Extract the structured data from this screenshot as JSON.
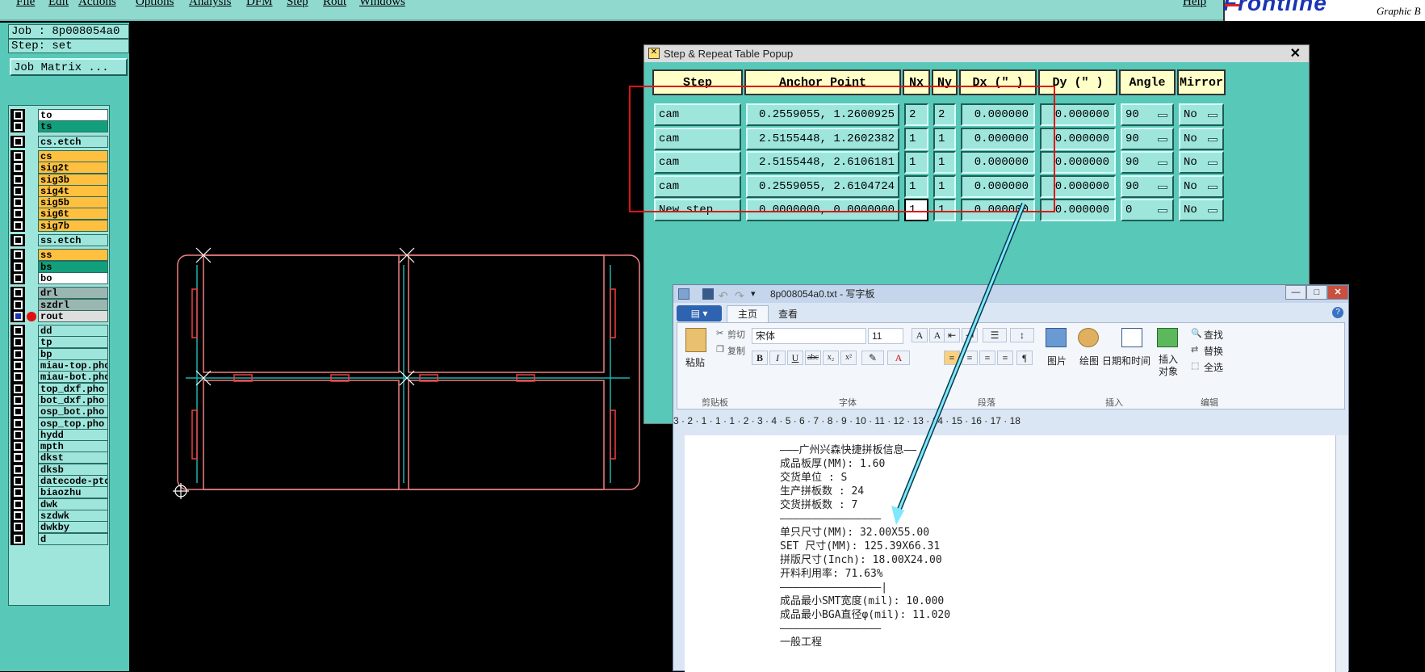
{
  "menubar": {
    "items": [
      "File",
      "Edit",
      "Actions",
      "Options",
      "Analysis",
      "DFM",
      "Step",
      "Rout",
      "Windows"
    ],
    "help": "Help",
    "brand": "Frontline",
    "brand_sub": "Graphic B"
  },
  "left_panel": {
    "job_label": "Job : 8p008054a0",
    "step_label": "Step: set",
    "job_matrix_button": "Job Matrix ...",
    "layers": [
      {
        "name": "to",
        "color": "#ffffff"
      },
      {
        "name": "ts",
        "color": "#12a07c"
      },
      {
        "name": "cs.etch",
        "color": "#9ee6dc"
      },
      {
        "name": "cs",
        "color": "#ffc040"
      },
      {
        "name": "sig2t",
        "color": "#ffc040"
      },
      {
        "name": "sig3b",
        "color": "#ffc040"
      },
      {
        "name": "sig4t",
        "color": "#ffc040"
      },
      {
        "name": "sig5b",
        "color": "#ffc040"
      },
      {
        "name": "sig6t",
        "color": "#ffc040"
      },
      {
        "name": "sig7b",
        "color": "#ffc040"
      },
      {
        "name": "ss.etch",
        "color": "#9ee6dc"
      },
      {
        "name": "ss",
        "color": "#ffc040"
      },
      {
        "name": "bs",
        "color": "#12a07c"
      },
      {
        "name": "bo",
        "color": "#ffffff"
      },
      {
        "name": "drl",
        "color": "#9ab6b0"
      },
      {
        "name": "szdrl",
        "color": "#9ab6b0"
      },
      {
        "name": "rout",
        "color": "#dedede"
      },
      {
        "name": "dd",
        "color": "#9ee6dc"
      },
      {
        "name": "tp",
        "color": "#9ee6dc"
      },
      {
        "name": "bp",
        "color": "#9ee6dc"
      },
      {
        "name": "miau-top.pho",
        "color": "#9ee6dc"
      },
      {
        "name": "miau-bot.pho",
        "color": "#9ee6dc"
      },
      {
        "name": "top_dxf.pho",
        "color": "#9ee6dc"
      },
      {
        "name": "bot_dxf.pho",
        "color": "#9ee6dc"
      },
      {
        "name": "osp_bot.pho",
        "color": "#9ee6dc"
      },
      {
        "name": "osp_top.pho",
        "color": "#9ee6dc"
      },
      {
        "name": "hydd",
        "color": "#9ee6dc"
      },
      {
        "name": "mpth",
        "color": "#9ee6dc"
      },
      {
        "name": "dkst",
        "color": "#9ee6dc"
      },
      {
        "name": "dksb",
        "color": "#9ee6dc"
      },
      {
        "name": "datecode-pto",
        "color": "#9ee6dc"
      },
      {
        "name": "biaozhu",
        "color": "#9ee6dc"
      },
      {
        "name": "dwk",
        "color": "#9ee6dc"
      },
      {
        "name": "szdwk",
        "color": "#9ee6dc"
      },
      {
        "name": "dwkby",
        "color": "#9ee6dc"
      },
      {
        "name": "d",
        "color": "#9ee6dc"
      }
    ]
  },
  "step_popup": {
    "title": "Step & Repeat Table Popup",
    "close": "✕",
    "headers": [
      "Step",
      "Anchor Point",
      "Nx",
      "Ny",
      "Dx (\" )",
      "Dy (\" )",
      "Angle",
      "Mirror"
    ],
    "rows": [
      {
        "step": "cam",
        "anchor": "0.2559055,  1.2600925",
        "nx": "2",
        "ny": "2",
        "dx": "0.000000",
        "dy": "0.000000",
        "angle": "90",
        "mirror": "No"
      },
      {
        "step": "cam",
        "anchor": "2.5155448,  1.2602382",
        "nx": "1",
        "ny": "1",
        "dx": "0.000000",
        "dy": "0.000000",
        "angle": "90",
        "mirror": "No"
      },
      {
        "step": "cam",
        "anchor": "2.5155448,  2.6106181",
        "nx": "1",
        "ny": "1",
        "dx": "0.000000",
        "dy": "0.000000",
        "angle": "90",
        "mirror": "No"
      },
      {
        "step": "cam",
        "anchor": "0.2559055,  2.6104724",
        "nx": "1",
        "ny": "1",
        "dx": "0.000000",
        "dy": "0.000000",
        "angle": "90",
        "mirror": "No"
      },
      {
        "step": "New step ...",
        "anchor": "0.0000000,  0.0000000",
        "nx": "1",
        "ny": "1",
        "dx": "0.000000",
        "dy": "0.000000",
        "angle": "0",
        "mirror": "No"
      }
    ]
  },
  "wordpad": {
    "title": "8p008054a0.txt - 写字板",
    "tabs": [
      "主页",
      "查看"
    ],
    "clipboard": {
      "paste": "粘贴",
      "cut": "剪切",
      "copy": "复制",
      "group": "剪贴板"
    },
    "font": {
      "name": "宋体",
      "size": "11",
      "group": "字体"
    },
    "paragraph_group": "段落",
    "insert": {
      "picture": "图片",
      "paint": "绘图",
      "datetime": "日期和时间",
      "object": "插入对象",
      "group": "插入"
    },
    "edit": {
      "find": "查找",
      "replace": "替换",
      "select_all": "全选",
      "group": "编辑"
    },
    "ruler": "3 · 2 · 1 · 1 · 1 · 2 · 3 · 4 · 5 · 6 · 7 · 8 · 9 · 10 · 11 · 12 · 13 · 14 · 15 · 16 · 17 · 18",
    "lines": [
      "———广州兴森快捷拼板信息——",
      "成品板厚(MM): 1.60",
      "交货单位 : S",
      "生产拼板数 : 24",
      "交货拼板数 : 7",
      "————————————————",
      "单只尺寸(MM): 32.00X55.00",
      "SET 尺寸(MM): 125.39X66.31",
      "拼版尺寸(Inch): 18.00X24.00",
      "开料利用率: 71.63%",
      "————————————————|",
      "成品最小SMT宽度(mil): 10.000",
      "成品最小BGA直径φ(mil): 11.020",
      "————————————————",
      "一般工程"
    ]
  },
  "colors": {
    "highlight": "#e01010",
    "arrow": "#7fe8ff",
    "panel": "#58c8b8"
  }
}
